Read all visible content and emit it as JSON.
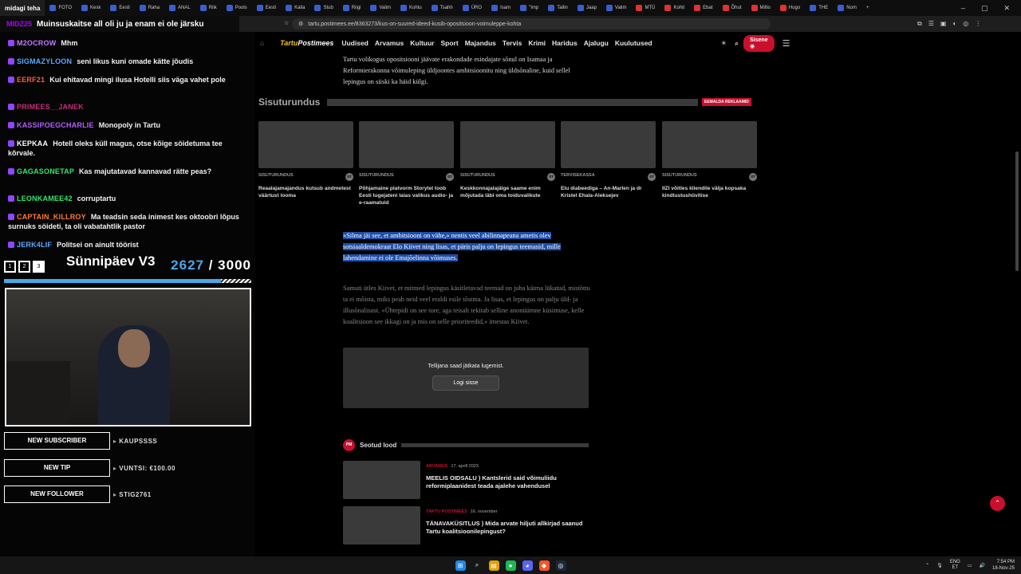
{
  "browser": {
    "tabs": [
      "FOTO",
      "Kesk",
      "Eesti",
      "Raha",
      "ANAL",
      "Riik",
      "Pools",
      "Eesti",
      "Kalla",
      "Stub",
      "Riigi",
      "Valim",
      "Kohtu",
      "Tsahh",
      "ÜRO",
      "Isam",
      "\"Imp",
      "Tallin",
      "Jaap",
      "Valim",
      "MTÜ",
      "Kohti",
      "Ebat",
      "Õhut",
      "Millis",
      "Hugo",
      "THE",
      "Nom"
    ],
    "new_tab": "+",
    "url": "tartu.postimees.ee/8363273/kus-on-suured-ideed-kusib-opositsioon-voimuleppe-kohta"
  },
  "stream": {
    "ticker_title": "midagi teha",
    "ticker_user": "MIDZ25",
    "ticker_msg": "Muinsuskaitse all oli ju ja enam ei ole järsku",
    "chat": [
      {
        "user": "M2OCROW",
        "msg": "Mhm",
        "color": "#c07aff"
      },
      {
        "user": "SIGMAZYLOON",
        "msg": "seni likus kuni omade kätte jõudis",
        "color": "#5aa7ff"
      },
      {
        "user": "EERF21",
        "msg": "Kui ehitavad mingi ilusa Hotelli siis väga vahet pole",
        "color": "#ff5a3c"
      },
      {
        "user": "PRIMEES__JANEK",
        "msg": "",
        "color": "#c0307a"
      },
      {
        "user": "KASSIPOEGCHARLIE",
        "msg": "Monopoly in Tartu",
        "color": "#b45cff"
      },
      {
        "user": "KEPKAA",
        "msg": "Hotell oleks küll magus, otse kõige söidetuma tee kõrvale.",
        "color": "#ffffff"
      },
      {
        "user": "GAGASONETAP",
        "msg": "Kas majutatavad kannavad rätte peas?",
        "color": "#2ee86a"
      },
      {
        "user": "LEONKAMEE42",
        "msg": "corruptartu",
        "color": "#2ee86a"
      },
      {
        "user": "CAPTAIN_KILLROY",
        "msg": "Ma teadsin seda inimest kes oktoobri lõpus surnuks söideti, ta oli vabatahtlik pastor",
        "color": "#ff7a2a"
      },
      {
        "user": "JERK4LIF",
        "msg": "Politsei on ainult töörist",
        "color": "#5aa7ff"
      }
    ],
    "goal": {
      "steps": [
        "1",
        "2",
        "3"
      ],
      "title": "Sünnipäev V3",
      "current": "2627",
      "total": "/ 3000",
      "progress": 0.876
    },
    "alerts": [
      {
        "label": "NEW SUBSCRIBER",
        "value": "KAUPSSSS"
      },
      {
        "label": "NEW TIP",
        "value": "VUNTSI: €100.00"
      },
      {
        "label": "NEW FOLLOWER",
        "value": "STIG2761"
      }
    ]
  },
  "site": {
    "logo_a": "Tartu",
    "logo_b": "Postimees",
    "nav": [
      "Uudised",
      "Arvamus",
      "Kultuur",
      "Sport",
      "Majandus",
      "Tervis",
      "Krimi",
      "Haridus",
      "Ajalugu",
      "Kuulutused"
    ],
    "signin": "Sisene"
  },
  "article": {
    "intro": "Tartu volikogus opositsiooni jäävate erakondade esindajate sõnul on Isamaa ja Reformierakonna võimuleping üldjoontes ambitsioonitu ning üldsõnaline, kuid sellel lepingus on siiski ka häid külgi.",
    "section": "Sisuturundus",
    "remove_ads": "EEMALDA REKLAAMID",
    "cards": [
      {
        "cat": "SISUTURUNDUS",
        "title": "Reaalajamajandus kutsub andmetest väärtust looma"
      },
      {
        "cat": "SISUTURUNDUS",
        "title": "Põhjamaine platvorm Storytel toob Eesti lugejateni laias valikus audio- ja e-raamatuid"
      },
      {
        "cat": "SISUTURUNDUS",
        "title": "Keskkonnajalajälge saame enim mõjutada läbi oma toiduvalikute"
      },
      {
        "cat": "TERVISEKASSA",
        "title": "Elu diabeediga – An-Marlen ja dr Kristel Ehala-Aleksejev"
      },
      {
        "cat": "SISUTURUNDUS",
        "title": "IIZI võitles kliendile välja kopsaka kindlustushüvitise"
      }
    ],
    "st": "ST",
    "quote": "«Silma jäi see, et ambitsiooni on vähe,» nentis veel abilinnapeana ametis olev sotsiaaldemokraat Elo Kiivet ning lisas, et päris palju on lepingus teemasid, mille lahendamine ei ole Emajõelinna võimuses.",
    "body": "Samuti ütles Kiivet, et mitmed lepingus käsitletavad teemad on juba käima lükatud, mistõttu ta ei mõista, miks peab neid veel eraldi esile tõstma. Ja lisas, et lepingus on palju üld- ja illusõnalisust. «Ühtepidi on see tore, aga teisalt tekitab selline anonüümne küsimuse, kelle koalitsioon see ikkagi on ja mis on selle prioriteedid,» imestas Kiivet.",
    "paywall_msg": "Tellijana saad jätkata lugemist.",
    "login": "Logi sisse",
    "related_title": "Seotud lood",
    "related": [
      {
        "cat": "ARVAMUS",
        "date": "17. aprill 2023",
        "title": "MEELIS OIDSALU ) Kantslerid said võimuliidu reformiplaanidest teada ajalehe vahendusel"
      },
      {
        "cat": "TARTU POSTIMEES",
        "date": "16. november",
        "title": "TÄNAVAKÜSITLUS ) Mida arvate hiljuti allkirjad saanud Tartu koalitsioonilepingust?"
      }
    ]
  },
  "tray": {
    "lang": "ENG",
    "lang2": "ET",
    "time": "7:54 PM",
    "date": "18-Nov-25"
  },
  "colors": {
    "accent": "#c8102e",
    "highlight": "#1f4fa8",
    "goal": "#4aa7e8"
  }
}
